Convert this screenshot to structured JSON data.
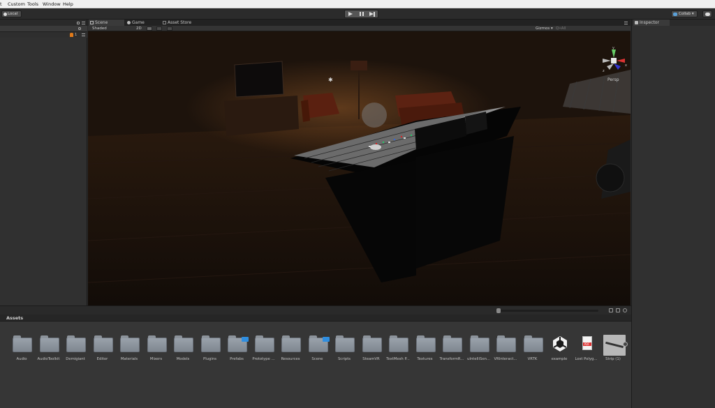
{
  "menubar": {
    "items": [
      "t",
      "Custom",
      "Tools",
      "Window",
      "Help"
    ]
  },
  "toolbar": {
    "local_label": "Local",
    "collab_label": "Collab ▾"
  },
  "hierarchy": {
    "count": "1"
  },
  "scene": {
    "tabs": {
      "scene": "Scene",
      "game": "Game",
      "asset_store": "Asset Store"
    },
    "shading_mode": "Shaded",
    "mode_2d": "2D",
    "gizmos_label": "Gizmos ▾",
    "search_placeholder": "Q•All",
    "persp_label": "Persp",
    "gizmo_axes": {
      "y": "y",
      "x": "x",
      "z": "z"
    }
  },
  "inspector": {
    "tab_label": "Inspector"
  },
  "assets": {
    "header": "Assets",
    "items": [
      {
        "label": "Audio",
        "kind": "folder",
        "badge": false
      },
      {
        "label": "AudioToolkit",
        "kind": "folder",
        "badge": false
      },
      {
        "label": "Demigiant",
        "kind": "folder",
        "badge": false
      },
      {
        "label": "Editor",
        "kind": "folder",
        "badge": false
      },
      {
        "label": "Materials",
        "kind": "folder",
        "badge": false
      },
      {
        "label": "Mixers",
        "kind": "folder",
        "badge": false
      },
      {
        "label": "Models",
        "kind": "folder",
        "badge": false
      },
      {
        "label": "Plugins",
        "kind": "folder",
        "badge": false
      },
      {
        "label": "Prefabs",
        "kind": "folder",
        "badge": true
      },
      {
        "label": "Prototype ...",
        "kind": "folder",
        "badge": false
      },
      {
        "label": "Resources",
        "kind": "folder",
        "badge": false
      },
      {
        "label": "Scene",
        "kind": "folder",
        "badge": true
      },
      {
        "label": "Scripts",
        "kind": "folder",
        "badge": false
      },
      {
        "label": "SteamVR",
        "kind": "folder",
        "badge": false
      },
      {
        "label": "TextMesh P...",
        "kind": "folder",
        "badge": false
      },
      {
        "label": "Textures",
        "kind": "folder",
        "badge": false
      },
      {
        "label": "TransformR...",
        "kind": "folder",
        "badge": false
      },
      {
        "label": "uIntelliSen...",
        "kind": "folder",
        "badge": false
      },
      {
        "label": "VRInteract...",
        "kind": "folder",
        "badge": false
      },
      {
        "label": "VRTK",
        "kind": "folder",
        "badge": false
      },
      {
        "label": "example",
        "kind": "unity",
        "badge": false
      },
      {
        "label": "Lost Polyg...",
        "kind": "pdf",
        "badge": false
      },
      {
        "label": "Strip (1)",
        "kind": "prefab",
        "badge": false
      }
    ]
  },
  "colors": {
    "accent_blue": "#2f8ee0",
    "hierarchy_icon_orange": "#e07a1a",
    "gizmo_x": "#d33",
    "gizmo_y": "#6c6",
    "gizmo_z": "#33c"
  }
}
